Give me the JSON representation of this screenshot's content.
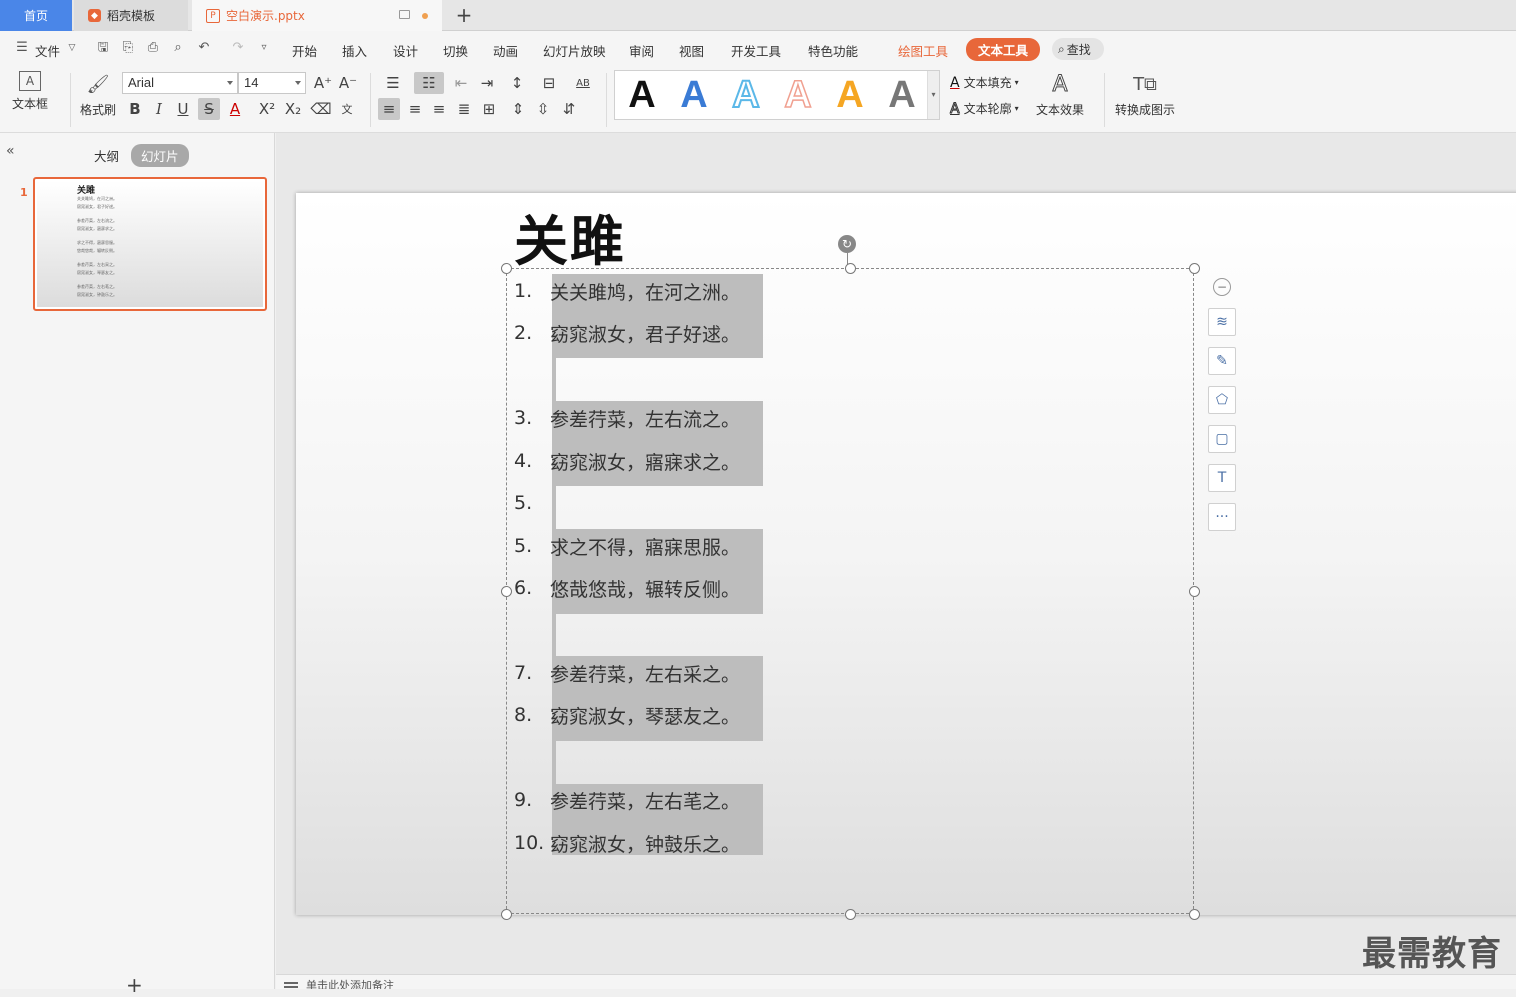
{
  "tabs": {
    "home": "首页",
    "template": "稻壳模板",
    "document": "空白演示.pptx"
  },
  "menu": {
    "file": "文件",
    "items": [
      "开始",
      "插入",
      "设计",
      "切换",
      "动画",
      "幻灯片放映",
      "审阅",
      "视图",
      "开发工具",
      "特色功能"
    ],
    "drawing_tools": "绘图工具",
    "text_tools": "文本工具",
    "search": "查找"
  },
  "ribbon": {
    "textbox": "文本框",
    "format_painter": "格式刷",
    "font_name": "Arial",
    "font_size": "14",
    "text_fill": "文本填充",
    "text_outline": "文本轮廓",
    "text_effect": "文本效果",
    "convert_graphic": "转换成图示",
    "style_letter": "A",
    "style_colors": [
      "#111111",
      "#3a7bd5",
      "#5bb8e8",
      "#f0a090",
      "#f5a623",
      "#777777"
    ]
  },
  "left_panel": {
    "outline_tab": "大纲",
    "slides_tab": "幻灯片",
    "slide_number": "1",
    "add_slide": "+"
  },
  "slide": {
    "title": "关雎",
    "lines": [
      {
        "num": "1.",
        "text": "关关雎鸠，在河之洲。"
      },
      {
        "num": "2.",
        "text": "窈窕淑女，君子好逑。"
      },
      {
        "num": "3.",
        "text": "参差荇菜，左右流之。"
      },
      {
        "num": "4.",
        "text": "窈窕淑女，寤寐求之。"
      },
      {
        "num": "5.",
        "text": ""
      },
      {
        "num": "5.",
        "text": "求之不得，寤寐思服。"
      },
      {
        "num": "6.",
        "text": "悠哉悠哉，辗转反侧。"
      },
      {
        "num": "7.",
        "text": "参差荇菜，左右采之。"
      },
      {
        "num": "8.",
        "text": "窈窕淑女，琴瑟友之。"
      },
      {
        "num": "9.",
        "text": "参差荇菜，左右芼之。"
      },
      {
        "num": "10.",
        "text": "窈窕淑女，钟鼓乐之。"
      }
    ]
  },
  "notes_placeholder": "单击此处添加备注",
  "watermark": "最需教育",
  "accent_color": "#e8673a"
}
